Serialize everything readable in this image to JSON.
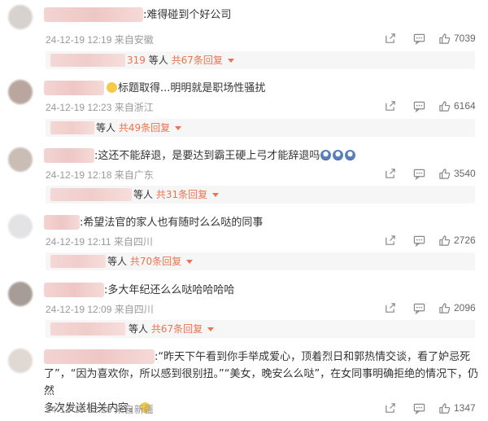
{
  "icons": {
    "share": "share-icon",
    "comment": "comment-icon",
    "like": "thumb-up-icon"
  },
  "colors": {
    "accent": "#eb7350",
    "meta": "#999999",
    "reply_bg": "#f6f6f6"
  },
  "comments": [
    {
      "text": ":难得碰到个好公司",
      "meta": "24-12-19 12:19 来自安徽",
      "likes": "7039",
      "reply": {
        "count": "319",
        "people": "等人",
        "total": "共67条回复"
      }
    },
    {
      "text": "标题取得...明明就是职场性骚扰",
      "meta": "24-12-19 12:23 来自浙江",
      "likes": "6164",
      "reply": {
        "count": "",
        "people": "等人",
        "total": "共49条回复"
      }
    },
    {
      "text": ":这还不能辞退，是要达到霸王硬上弓才能辞退吗",
      "meta": "24-12-19 12:18 来自广东",
      "likes": "3540",
      "reply": {
        "count": "",
        "people": "等人",
        "total": "共31条回复"
      }
    },
    {
      "text": ":希望法官的家人也有随时么么哒的同事",
      "meta": "24-12-19 12:11 来自四川",
      "likes": "2726",
      "reply": {
        "count": "",
        "people": "等人",
        "total": "共70条回复"
      }
    },
    {
      "text": ":多大年纪还么么哒哈哈哈哈",
      "meta": "24-12-19 12:09 来自四川",
      "likes": "2096",
      "reply": {
        "count": "",
        "people": "等人",
        "total": "共67条回复"
      }
    },
    {
      "text_lines": [
        ":“昨天下午看到你手举成爱心，顶着烈日和郭热情交谈，看了妒忌死",
        "了”，“因为喜欢你，所以感到很别扭。”“美女，晚安么么哒”，在女同事明确拒绝的情况下，仍然",
        "多次发送相关内容。"
      ],
      "meta": "24-12-19 12:26 来自新疆",
      "likes": "1347"
    }
  ]
}
